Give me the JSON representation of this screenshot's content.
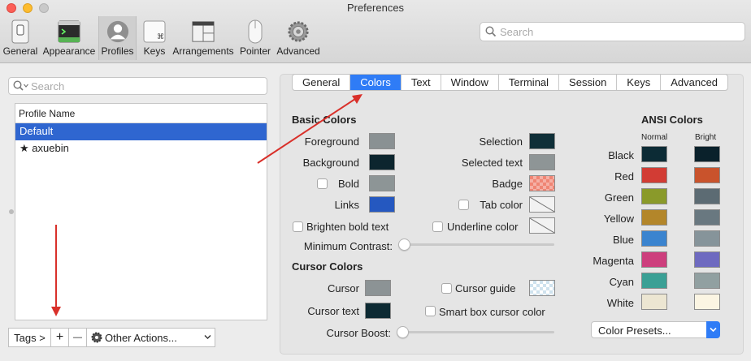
{
  "window": {
    "title": "Preferences"
  },
  "toolbar": {
    "items": [
      {
        "label": "General",
        "icon": "switch-icon"
      },
      {
        "label": "Appearance",
        "icon": "terminal-window-icon"
      },
      {
        "label": "Profiles",
        "icon": "person-silhouette-icon"
      },
      {
        "label": "Keys",
        "icon": "command-key-icon"
      },
      {
        "label": "Arrangements",
        "icon": "window-layout-icon"
      },
      {
        "label": "Pointer",
        "icon": "mouse-icon"
      },
      {
        "label": "Advanced",
        "icon": "gear-icon"
      }
    ],
    "selected": "Profiles",
    "search_placeholder": "Search"
  },
  "profiles": {
    "search_placeholder": "Search",
    "column_header": "Profile Name",
    "rows": [
      {
        "name": "Default",
        "selected": true,
        "prefix": ""
      },
      {
        "name": "axuebin",
        "selected": false,
        "prefix": "★"
      }
    ],
    "bottom_bar": {
      "tags": "Tags >",
      "add": "+",
      "remove": "—",
      "other_actions": "Other Actions..."
    }
  },
  "tabs": [
    "General",
    "Colors",
    "Text",
    "Window",
    "Terminal",
    "Session",
    "Keys",
    "Advanced"
  ],
  "active_tab": "Colors",
  "basic_colors": {
    "title": "Basic Colors",
    "foreground": {
      "label": "Foreground",
      "color": "#8a9193"
    },
    "background": {
      "label": "Background",
      "color": "#0c252e"
    },
    "bold": {
      "label": "Bold",
      "color": "#8d9596",
      "checked": false
    },
    "links": {
      "label": "Links",
      "color": "#2558c0"
    },
    "selection": {
      "label": "Selection",
      "color": "#0f2f38"
    },
    "selected_text": {
      "label": "Selected text",
      "color": "#8e9596"
    },
    "badge": {
      "label": "Badge",
      "color": "#ef8574"
    },
    "tab_color": {
      "label": "Tab color",
      "checked": false
    },
    "brighten_bold": {
      "label": "Brighten bold text",
      "checked": false
    },
    "underline_color": {
      "label": "Underline color",
      "checked": false
    },
    "minimum_contrast": {
      "label": "Minimum Contrast:",
      "value": 0
    }
  },
  "cursor_colors": {
    "title": "Cursor Colors",
    "cursor": {
      "label": "Cursor",
      "color": "#8c9395"
    },
    "cursor_text": {
      "label": "Cursor text",
      "color": "#0d2a33"
    },
    "cursor_guide": {
      "label": "Cursor guide",
      "checked": false
    },
    "smart_box": {
      "label": "Smart box cursor color",
      "checked": false
    },
    "cursor_boost": {
      "label": "Cursor Boost:",
      "value": 0
    }
  },
  "ansi_colors": {
    "title": "ANSI Colors",
    "normal_label": "Normal",
    "bright_label": "Bright",
    "rows": [
      {
        "name": "Black",
        "normal": "#0c2b35",
        "bright": "#0a212b"
      },
      {
        "name": "Red",
        "normal": "#d23c34",
        "bright": "#c9532c"
      },
      {
        "name": "Green",
        "normal": "#8a9a2a",
        "bright": "#5c6b73"
      },
      {
        "name": "Yellow",
        "normal": "#b3862a",
        "bright": "#697880"
      },
      {
        "name": "Blue",
        "normal": "#3b84cf",
        "bright": "#86949a"
      },
      {
        "name": "Magenta",
        "normal": "#cd3f7d",
        "bright": "#6e6ac0"
      },
      {
        "name": "Cyan",
        "normal": "#3aa095",
        "bright": "#91a0a1"
      },
      {
        "name": "White",
        "normal": "#ece6d2",
        "bright": "#fbf5e3"
      }
    ]
  },
  "color_presets": {
    "label": "Color Presets..."
  },
  "colors": {
    "accent": "#2f7cf6",
    "selection_row": "#2f66d0",
    "annotation_arrow": "#d9302a"
  }
}
